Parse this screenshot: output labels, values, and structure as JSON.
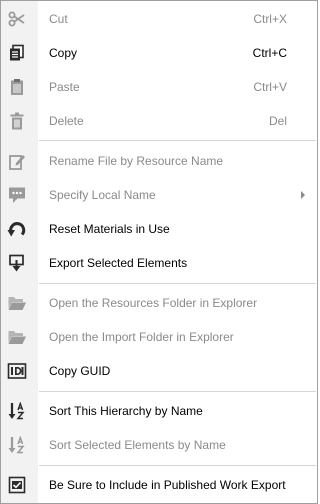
{
  "menu": {
    "items": [
      {
        "label": "Cut",
        "shortcut": "Ctrl+X",
        "enabled": false,
        "icon": "scissors-icon"
      },
      {
        "label": "Copy",
        "shortcut": "Ctrl+C",
        "enabled": true,
        "icon": "copy-icon"
      },
      {
        "label": "Paste",
        "shortcut": "Ctrl+V",
        "enabled": false,
        "icon": "clipboard-icon"
      },
      {
        "label": "Delete",
        "shortcut": "Del",
        "enabled": false,
        "icon": "trash-icon"
      },
      {
        "label": "Rename File by Resource Name",
        "enabled": false,
        "icon": "pencil-doc-icon"
      },
      {
        "label": "Specify Local Name",
        "enabled": false,
        "icon": "speech-bubble-icon",
        "has_submenu": true
      },
      {
        "label": "Reset Materials in Use",
        "enabled": true,
        "icon": "reset-arrow-icon"
      },
      {
        "label": "Export Selected Elements",
        "enabled": true,
        "icon": "export-icon"
      },
      {
        "label": "Open the Resources Folder in Explorer",
        "enabled": false,
        "icon": "folder-open-icon"
      },
      {
        "label": "Open the Import Folder in Explorer",
        "enabled": false,
        "icon": "folder-open-icon"
      },
      {
        "label": "Copy GUID",
        "enabled": true,
        "icon": "id-card-icon"
      },
      {
        "label": "Sort This Hierarchy by Name",
        "enabled": true,
        "icon": "sort-az-icon"
      },
      {
        "label": "Sort Selected Elements by Name",
        "enabled": false,
        "icon": "sort-az-icon"
      },
      {
        "label": "Be Sure to Include in Published Work Export",
        "enabled": true,
        "icon": "checkbox-icon"
      }
    ]
  },
  "colors": {
    "enabled_icon": "#2b2b2b",
    "disabled_icon": "#9a9a9a",
    "enabled_text": "#000000",
    "disabled_text": "#8a8a8a"
  }
}
